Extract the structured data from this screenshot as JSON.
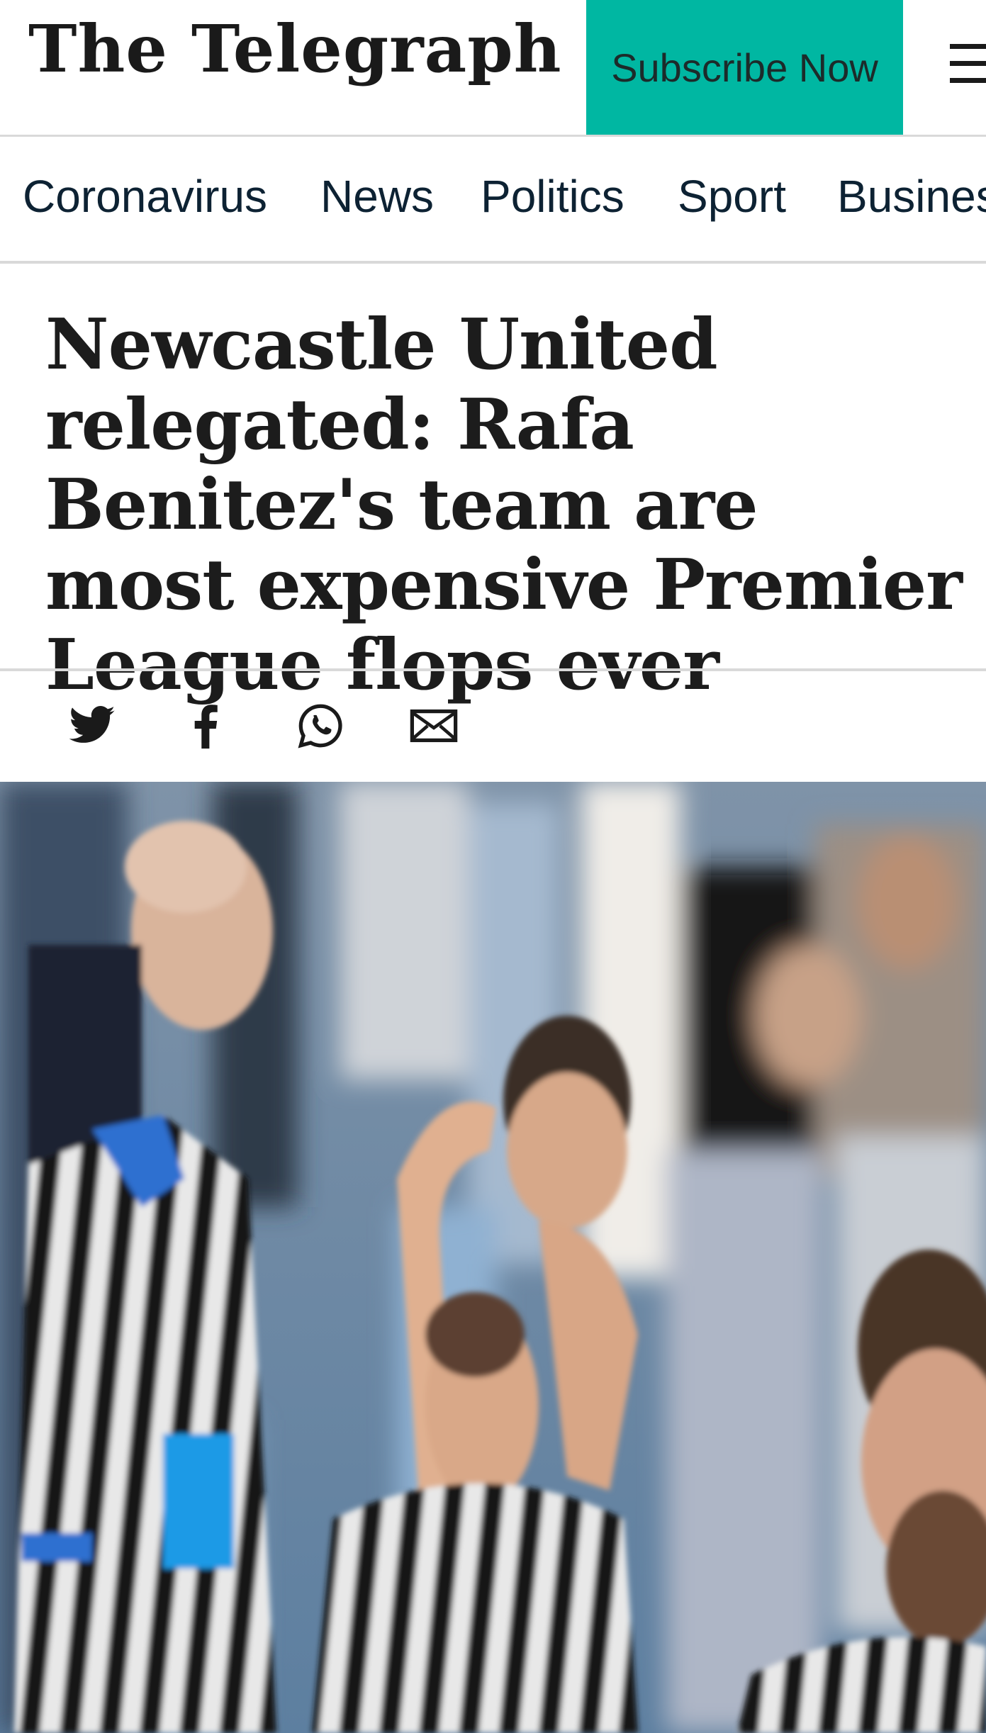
{
  "header": {
    "logo_text": "The Telegraph",
    "subscribe_label": "Subscribe Now",
    "menu_icon": "hamburger-menu-icon"
  },
  "nav": {
    "items": [
      {
        "label": "Coronavirus"
      },
      {
        "label": "News"
      },
      {
        "label": "Politics"
      },
      {
        "label": "Sport"
      },
      {
        "label": "Business"
      }
    ]
  },
  "article": {
    "headline": "Newcastle United relegated: Rafa Benitez's team are most expensive Premier League flops ever"
  },
  "share": {
    "icons": [
      "twitter-icon",
      "facebook-icon",
      "whatsapp-icon",
      "email-icon"
    ]
  },
  "colors": {
    "subscribe_bg": "#00b7a2",
    "nav_text": "#0d2233",
    "divider": "#d9d9d9"
  }
}
